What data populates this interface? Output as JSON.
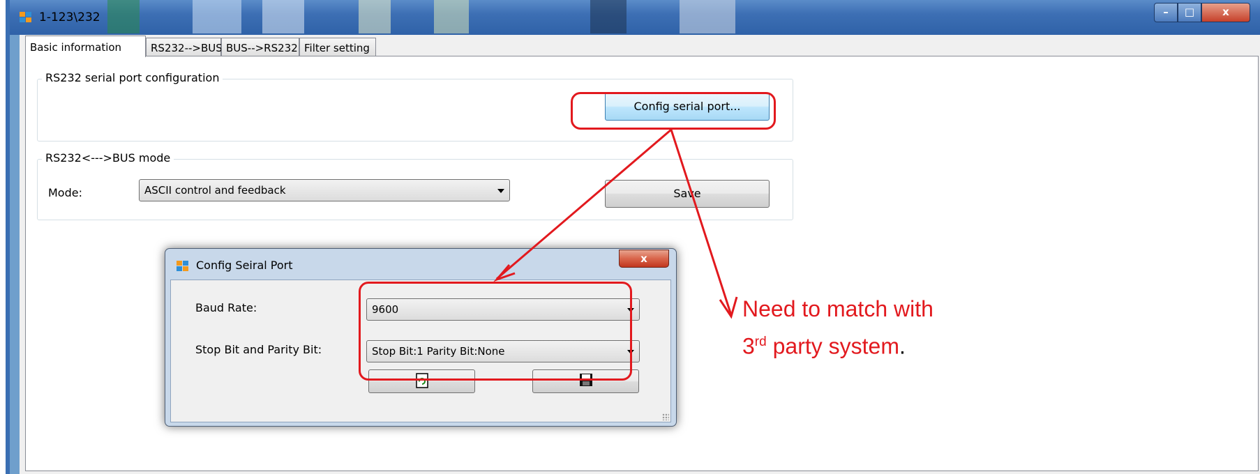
{
  "window": {
    "title": "1-123\\232"
  },
  "tabs": [
    {
      "label": "Basic information",
      "active": true
    },
    {
      "label": "RS232-->BUS"
    },
    {
      "label": "BUS-->RS232"
    },
    {
      "label": "Filter setting"
    }
  ],
  "serial_group": {
    "legend": "RS232 serial port configuration",
    "config_button": "Config serial port..."
  },
  "mode_group": {
    "legend": "RS232<--->BUS mode",
    "mode_label": "Mode:",
    "mode_value": "ASCII control and feedback",
    "save_button": "Save"
  },
  "dialog": {
    "title": "Config Seiral Port",
    "close_label": "x",
    "baud_label": "Baud Rate:",
    "baud_value": "9600",
    "stop_label": "Stop Bit and Parity Bit:",
    "stop_value": "Stop Bit:1 Parity Bit:None"
  },
  "annotation": {
    "line1": "Need to match with",
    "line2_prefix": "3",
    "line2_sup": "rd",
    "line2_rest": " party system",
    "line2_end": "."
  },
  "colors": {
    "annotation": "#e2191e",
    "titlebar": "#3d6fb4",
    "dialog_frame": "#c8d8ea"
  },
  "icons": {
    "refresh_button": "refresh-icon",
    "save_button": "floppy-disk-icon"
  }
}
